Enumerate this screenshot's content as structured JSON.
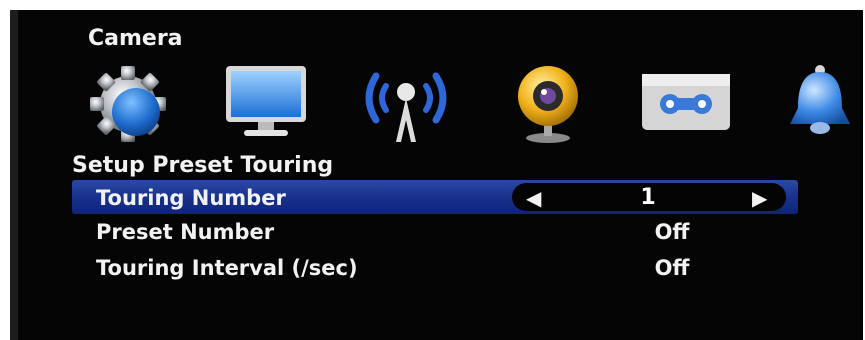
{
  "header": {
    "title": "Camera"
  },
  "icons": [
    {
      "name": "gear-icon"
    },
    {
      "name": "monitor-icon"
    },
    {
      "name": "wireless-antenna-icon"
    },
    {
      "name": "webcam-icon"
    },
    {
      "name": "cassette-icon"
    },
    {
      "name": "bell-icon"
    }
  ],
  "section": {
    "title": "Setup Preset Touring"
  },
  "rows": [
    {
      "label": "Touring Number",
      "value": "1",
      "selected": true
    },
    {
      "label": "Preset Number",
      "value": "Off"
    },
    {
      "label": "Touring Interval (/sec)",
      "value": "Off"
    }
  ],
  "colors": {
    "background": "#050505",
    "highlight": "#1d3a98",
    "text": "#f2f2f2"
  }
}
